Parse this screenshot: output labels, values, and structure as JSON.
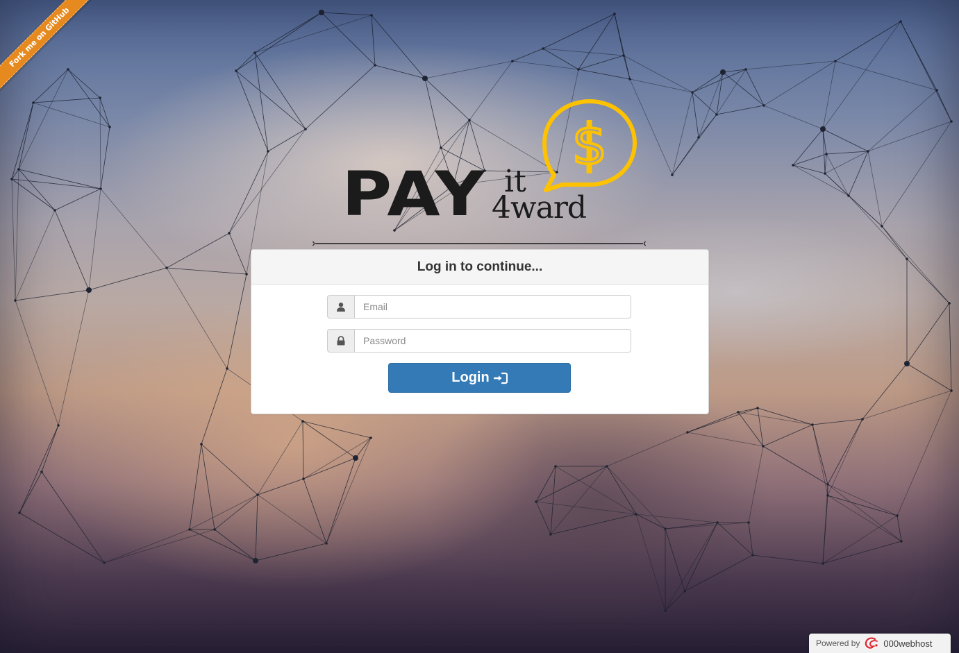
{
  "ribbon": {
    "label": "Fork me on GitHub",
    "color": "#e68a1f"
  },
  "logo": {
    "word_pay": "PAY",
    "word_it": "it",
    "word_4ward": "4ward",
    "bubble_symbol": "$",
    "bubble_color": "#ffc200"
  },
  "panel": {
    "heading": "Log in to continue...",
    "email": {
      "icon": "user-icon",
      "value": "",
      "placeholder": "Email"
    },
    "password": {
      "icon": "lock-icon",
      "value": "",
      "placeholder": "Password"
    },
    "login_button": {
      "label": "Login",
      "icon": "sign-in-icon",
      "color": "#337ab7"
    }
  },
  "footer": {
    "powered_label": "Powered by",
    "host_brand": "000webhost",
    "host_icon": "000webhost-logo-icon"
  }
}
